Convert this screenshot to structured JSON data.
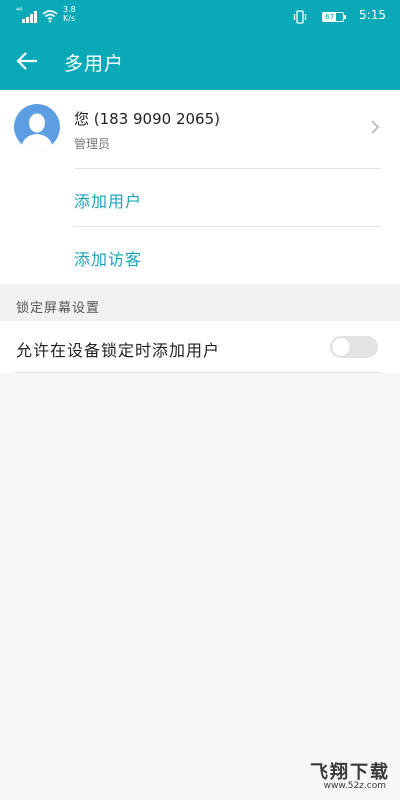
{
  "status_bar": {
    "signal_label": "⁴⁶",
    "net_speed_value": "3.8",
    "net_speed_unit": "K/s",
    "battery_level": "67",
    "time": "5:15",
    "icons": [
      "signal-icon",
      "wifi-icon",
      "vibrate-icon",
      "battery-icon"
    ],
    "battery_fraction": 0.67
  },
  "header": {
    "title": "多用户",
    "back_icon": "back-arrow-icon"
  },
  "current_user": {
    "name": "您 (183 9090 2065)",
    "role": "管理员",
    "avatar_icon": "avatar-icon"
  },
  "actions": {
    "add_user": "添加用户",
    "add_guest": "添加访客"
  },
  "lock_screen_section": {
    "title": "锁定屏幕设置",
    "allow_add_when_locked_label": "允许在设备锁定时添加用户",
    "allow_add_when_locked_enabled": false
  },
  "watermark": {
    "main": "飞翔下载",
    "sub": "www.52z.com"
  },
  "colors": {
    "primary": "#0aa9b8",
    "accent_text": "#16a4b6",
    "avatar_bg": "#5d9ee3",
    "background": "#f7f7f7"
  }
}
